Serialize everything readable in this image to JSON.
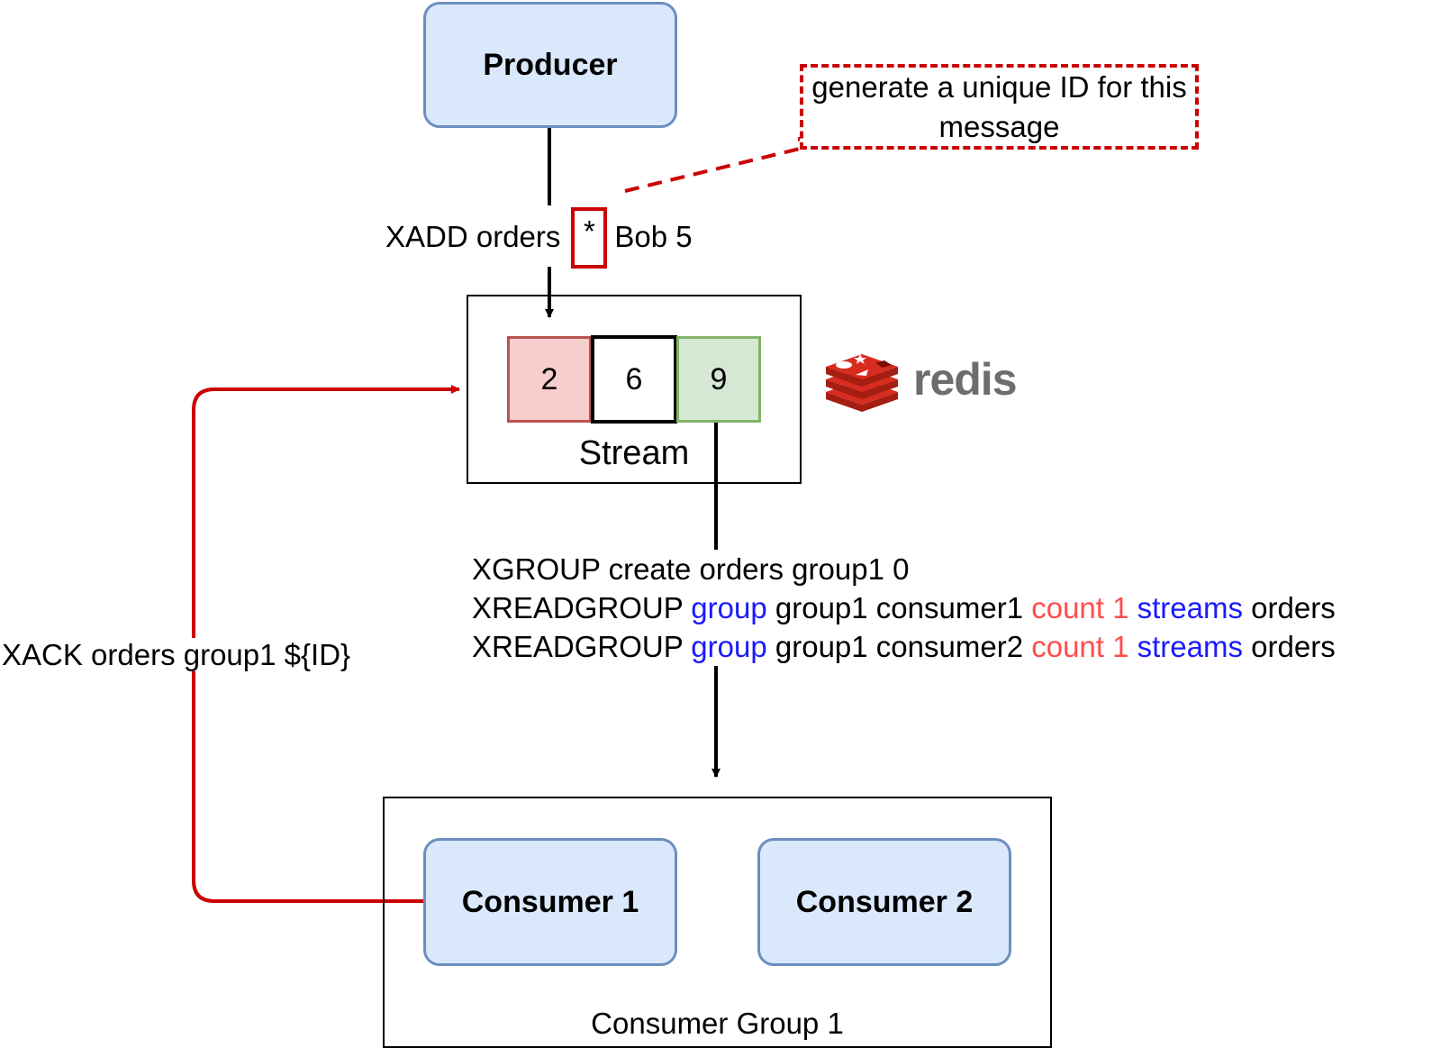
{
  "nodes": {
    "producer": "Producer",
    "stream_label": "Stream",
    "stream_entries": [
      "2",
      "6",
      "9"
    ],
    "consumer_group_label": "Consumer Group 1",
    "consumer1": "Consumer 1",
    "consumer2": "Consumer 2"
  },
  "note": {
    "text": "generate a unique ID for this message"
  },
  "edges": {
    "xadd": {
      "before": "XADD orders",
      "id_token": "*",
      "after": "Bob 5"
    },
    "xack": "XACK orders group1 ${ID}",
    "read_commands": {
      "line1": "XGROUP create orders group1 0",
      "line2": {
        "cmd": "XREADGROUP",
        "kw_group": "group",
        "args1": "group1 consumer1",
        "kw_count": "count 1",
        "kw_streams": "streams",
        "args2": "orders"
      },
      "line3": {
        "cmd": "XREADGROUP",
        "kw_group": "group",
        "args1": "group1 consumer2",
        "kw_count": "count 1",
        "kw_streams": "streams",
        "args2": "orders"
      }
    }
  },
  "logo": {
    "text": "redis",
    "icon": "redis-logo-icon"
  },
  "colors": {
    "node_fill": "#dae8fc",
    "node_stroke": "#6c8ebf",
    "entry_red_fill": "#f8cecc",
    "entry_red_stroke": "#b85450",
    "entry_green_fill": "#d5e8d4",
    "entry_green_stroke": "#82b366",
    "ack_edge": "#cc0000",
    "keyword_blue": "#1a1aff",
    "keyword_red": "#ff4d4d"
  }
}
